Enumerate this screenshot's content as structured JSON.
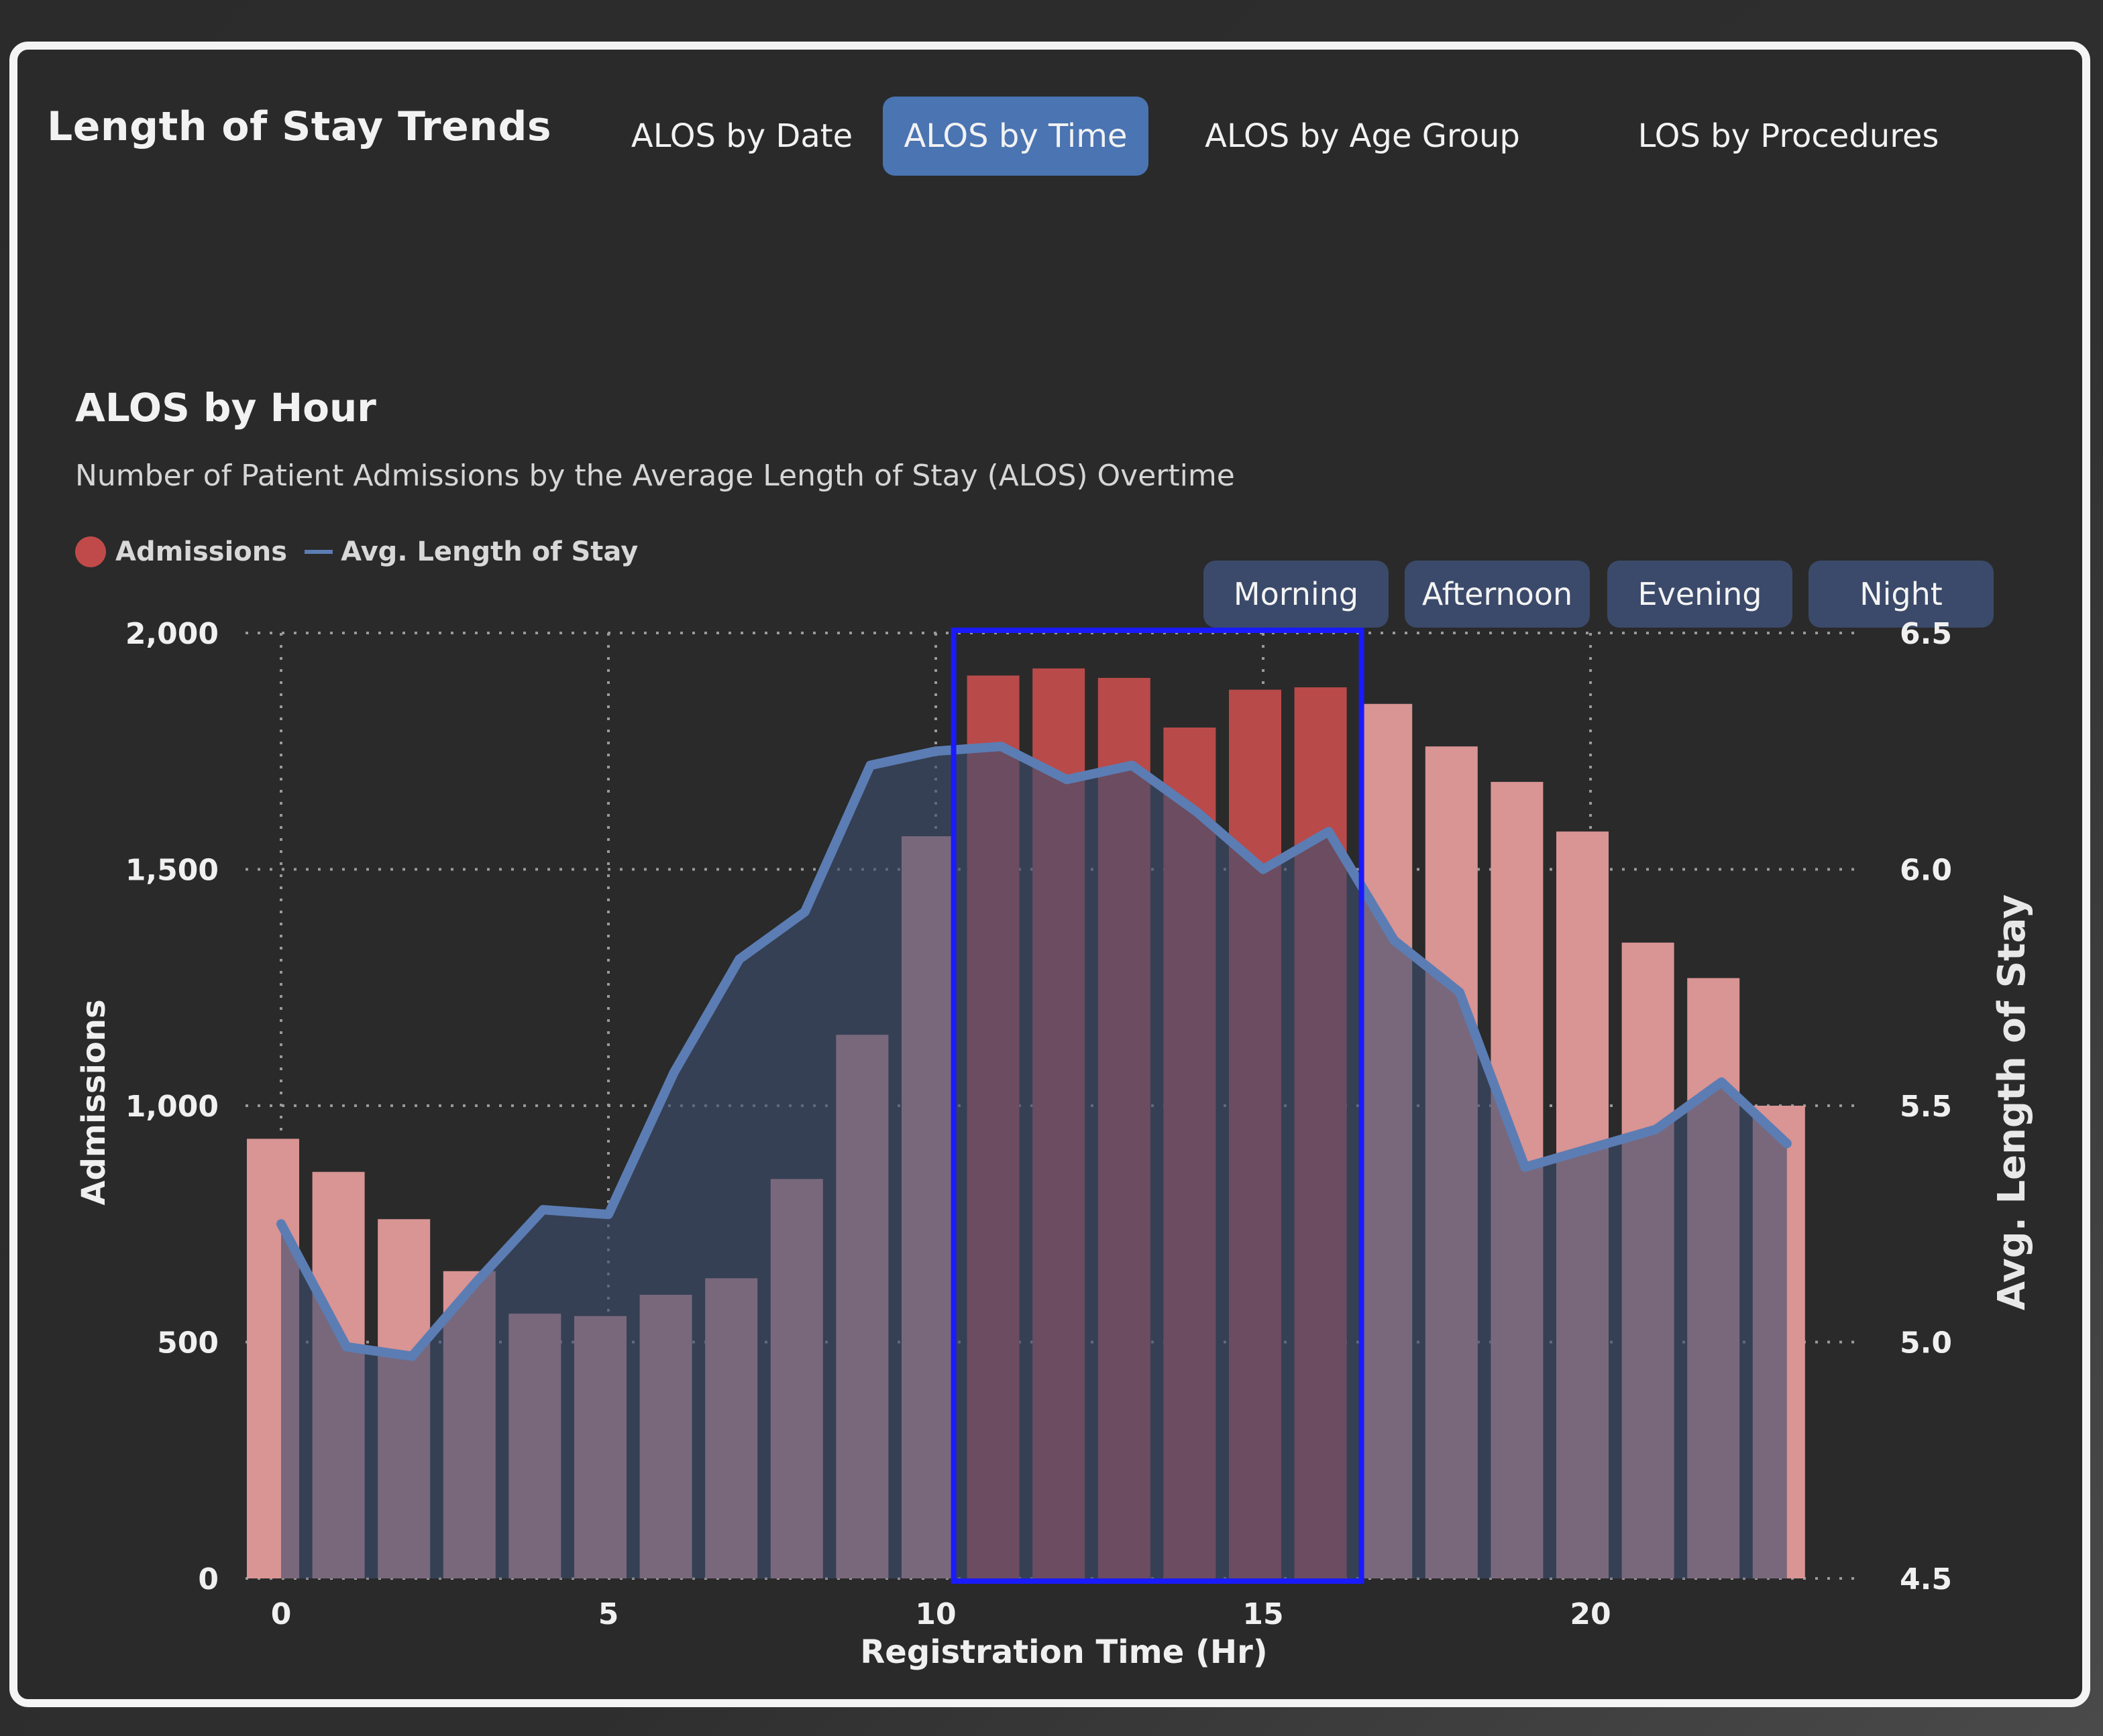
{
  "card": {
    "title": "Length of Stay Trends"
  },
  "tabs": [
    {
      "label": "ALOS by Date",
      "active": false
    },
    {
      "label": "ALOS by Time",
      "active": true
    },
    {
      "label": "ALOS by Age Group",
      "active": false
    },
    {
      "label": "LOS by Procedures",
      "active": false
    }
  ],
  "section": {
    "title": "ALOS by Hour",
    "subtitle": "Number of Patient Admissions by the Average Length of Stay (ALOS) Overtime"
  },
  "legend": {
    "admissions": "Admissions",
    "alos": "Avg. Length of Stay"
  },
  "slicers": [
    "Morning",
    "Afternoon",
    "Evening",
    "Night"
  ],
  "colors": {
    "accent": "#4a74b2",
    "bar_default": "#d99494",
    "bar_highlight": "#b94a4a",
    "line": "#5b7db4",
    "area": "#3d4e6e",
    "selection_box": "#1a1aff"
  },
  "chart_data": {
    "type": "bar",
    "x": [
      0,
      1,
      2,
      3,
      4,
      5,
      6,
      7,
      8,
      9,
      10,
      11,
      12,
      13,
      14,
      15,
      16,
      17,
      18,
      19,
      20,
      21,
      22,
      23
    ],
    "xlabel": "Registration Time (Hr)",
    "ylabel": "Admissions",
    "y2label": "Avg. Length of Stay",
    "xticks": [
      0,
      5,
      10,
      15,
      20
    ],
    "ylim": [
      0,
      2000
    ],
    "yticks": [
      0,
      500,
      1000,
      1500,
      2000
    ],
    "ytick_labels": [
      "0",
      "500",
      "1,000",
      "1,500",
      "2,000"
    ],
    "y2lim": [
      4.5,
      6.5
    ],
    "y2ticks": [
      4.5,
      5.0,
      5.5,
      6.0,
      6.5
    ],
    "y2tick_labels": [
      "4.5",
      "5.0",
      "5.5",
      "6.0",
      "6.5"
    ],
    "grid": true,
    "highlight_range": [
      11,
      16
    ],
    "series": [
      {
        "name": "Admissions",
        "type": "bar",
        "values": [
          930,
          860,
          760,
          650,
          560,
          555,
          600,
          635,
          845,
          1150,
          1570,
          1910,
          1925,
          1905,
          1800,
          1880,
          1885,
          1850,
          1760,
          1685,
          1580,
          1345,
          1270,
          1000
        ]
      },
      {
        "name": "Avg. Length of Stay",
        "type": "area",
        "values": [
          5.25,
          4.99,
          4.97,
          5.13,
          5.28,
          5.27,
          5.57,
          5.81,
          5.91,
          6.22,
          6.25,
          6.26,
          6.19,
          6.22,
          6.12,
          6.0,
          6.08,
          5.85,
          5.74,
          5.37,
          5.41,
          5.45,
          5.55,
          5.42
        ]
      }
    ]
  }
}
